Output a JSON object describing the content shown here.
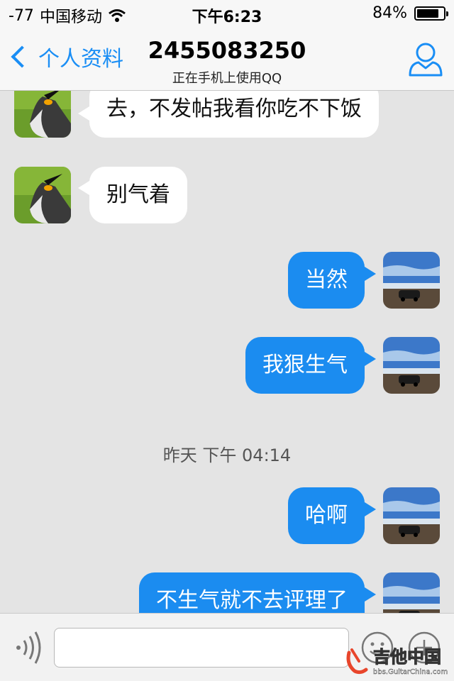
{
  "status_bar": {
    "signal": "-77",
    "carrier": "中国移动",
    "time": "下午6:23",
    "battery_text": "84%",
    "battery_level": 0.84
  },
  "nav": {
    "back_label": "个人资料",
    "title": "2455083250",
    "subtitle": "正在手机上使用QQ"
  },
  "messages": [
    {
      "side": "in",
      "text": "去，不发帖我看你吃不下饭",
      "avatar": "penguin-avatar"
    },
    {
      "side": "in",
      "text": "别气着",
      "avatar": "penguin-avatar"
    },
    {
      "side": "out",
      "text": "当然",
      "avatar": "car-beach-avatar"
    },
    {
      "side": "out",
      "text": "我狠生气",
      "avatar": "car-beach-avatar"
    },
    {
      "side": "out",
      "text": "哈啊",
      "avatar": "car-beach-avatar"
    },
    {
      "side": "out",
      "text": "不生气就不去评理了",
      "avatar": "car-beach-avatar"
    }
  ],
  "timestamp": "昨天 下午 04:14",
  "input": {
    "value": "",
    "placeholder": ""
  },
  "watermark": {
    "title": "吉他中国",
    "url": "bbs.GuitarChina.com"
  },
  "colors": {
    "accent": "#1a8ef5",
    "outgoing_bubble": "#1b8cf0",
    "incoming_bubble": "#ffffff",
    "chat_background": "#e4e4e4"
  }
}
